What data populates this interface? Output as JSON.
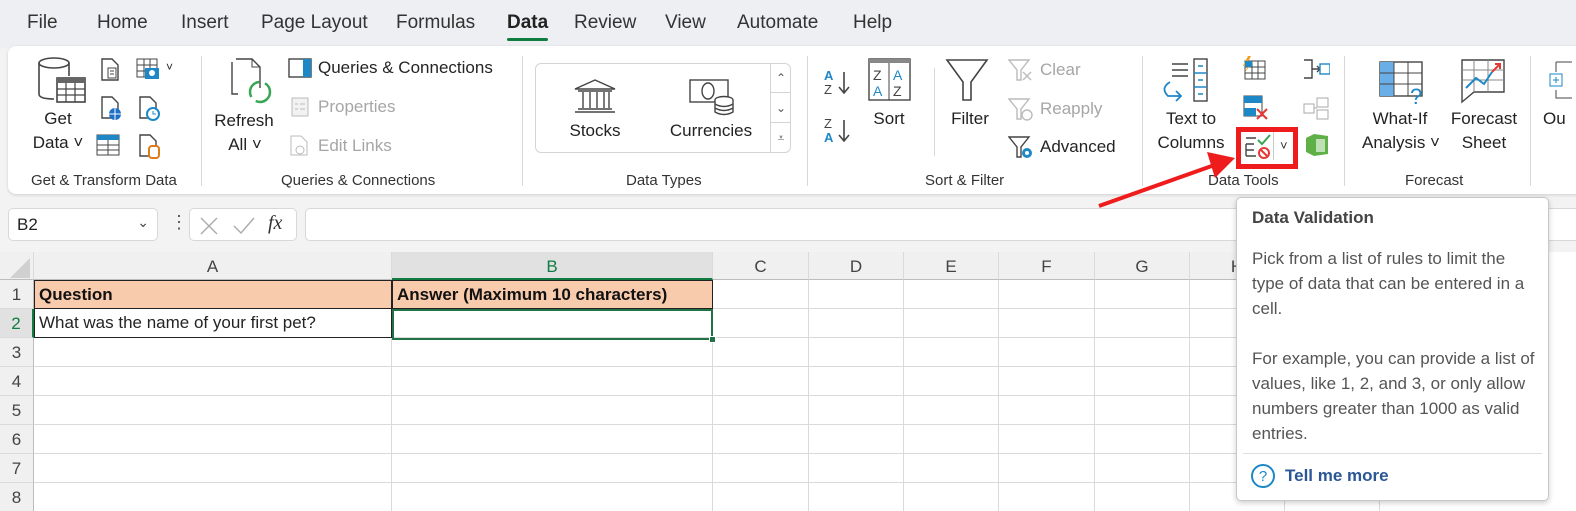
{
  "tabs": [
    {
      "label": "File",
      "active": false
    },
    {
      "label": "Home",
      "active": false
    },
    {
      "label": "Insert",
      "active": false
    },
    {
      "label": "Page Layout",
      "active": false
    },
    {
      "label": "Formulas",
      "active": false
    },
    {
      "label": "Data",
      "active": true
    },
    {
      "label": "Review",
      "active": false
    },
    {
      "label": "View",
      "active": false
    },
    {
      "label": "Automate",
      "active": false
    },
    {
      "label": "Help",
      "active": false
    }
  ],
  "ribbon": {
    "get_transform": {
      "group_label": "Get & Transform Data",
      "get_data_line1": "Get",
      "get_data_line2": "Data ˅"
    },
    "queries": {
      "group_label": "Queries & Connections",
      "refresh_line1": "Refresh",
      "refresh_line2": "All ˅",
      "queries_connections": "Queries & Connections",
      "properties": "Properties",
      "edit_links": "Edit Links"
    },
    "data_types": {
      "group_label": "Data Types",
      "stocks": "Stocks",
      "currencies": "Currencies"
    },
    "sort_filter": {
      "group_label": "Sort & Filter",
      "sort": "Sort",
      "filter": "Filter",
      "clear": "Clear",
      "reapply": "Reapply",
      "advanced": "Advanced"
    },
    "data_tools": {
      "group_label": "Data Tools",
      "text_to_columns_line1": "Text to",
      "text_to_columns_line2": "Columns"
    },
    "forecast": {
      "group_label": "Forecast",
      "what_if_line1": "What-If",
      "what_if_line2": "Analysis ˅",
      "forecast_line1": "Forecast",
      "forecast_line2": "Sheet"
    },
    "outline_partial": "Ou"
  },
  "formula_bar": {
    "name_box": "B2",
    "fx": "fx",
    "formula": ""
  },
  "grid": {
    "columns": [
      "A",
      "B",
      "C",
      "D",
      "E",
      "F",
      "G",
      "H"
    ],
    "rows": [
      "1",
      "2",
      "3",
      "4",
      "5",
      "6",
      "7",
      "8"
    ],
    "cells": {
      "A1": "Question",
      "B1": "Answer (Maximum 10 characters)",
      "A2": "What was the name of your first pet?",
      "B2": ""
    },
    "selected_cell": "B2"
  },
  "tooltip": {
    "title": "Data Validation",
    "para1": "Pick from a list of rules to limit the type of data that can be entered in a cell.",
    "para2": "For example, you can provide a list of values, like 1, 2, and 3, or only allow numbers greater than 1000 as valid entries.",
    "link": "Tell me more"
  },
  "colors": {
    "accent_green": "#107c41",
    "header_fill": "#f8cbad",
    "highlight_red": "#ee1c1c",
    "link_blue": "#2b5797"
  }
}
